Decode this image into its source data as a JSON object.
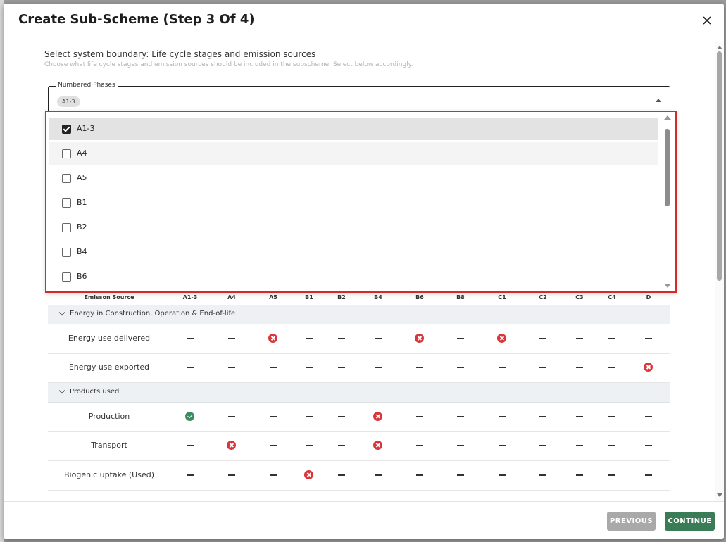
{
  "modal": {
    "title": "Create Sub-Scheme (Step 3 Of 4)",
    "close_icon": "close-icon"
  },
  "section": {
    "title": "Select system boundary: Life cycle stages and emission sources",
    "subtitle": "Choose what life cycle stages and emission sources should be included in the subscheme. Select below accordingly."
  },
  "phases_select": {
    "legend": "Numbered Phases",
    "chip": "A1-3",
    "options": [
      {
        "label": "A1-3",
        "checked": true
      },
      {
        "label": "A4",
        "checked": false
      },
      {
        "label": "A5",
        "checked": false
      },
      {
        "label": "B1",
        "checked": false
      },
      {
        "label": "B2",
        "checked": false
      },
      {
        "label": "B4",
        "checked": false
      },
      {
        "label": "B6",
        "checked": false
      }
    ]
  },
  "table": {
    "header_source": "Emisson Source",
    "columns": [
      "A1-3",
      "A4",
      "A5",
      "B1",
      "B2",
      "B4",
      "B6",
      "B8",
      "C1",
      "C2",
      "C3",
      "C4",
      "D"
    ],
    "groups": [
      {
        "label": "Energy in Construction, Operation & End-of-life",
        "rows": [
          {
            "label": "Energy use delivered",
            "cells": [
              "-",
              "-",
              "x",
              "-",
              "-",
              "-",
              "x",
              "-",
              "x",
              "-",
              "-",
              "-",
              "-"
            ]
          },
          {
            "label": "Energy use exported",
            "cells": [
              "-",
              "-",
              "-",
              "-",
              "-",
              "-",
              "-",
              "-",
              "-",
              "-",
              "-",
              "-",
              "x"
            ]
          }
        ]
      },
      {
        "label": "Products used",
        "rows": [
          {
            "label": "Production",
            "cells": [
              "check",
              "-",
              "-",
              "-",
              "-",
              "x",
              "-",
              "-",
              "-",
              "-",
              "-",
              "-",
              "-"
            ]
          },
          {
            "label": "Transport",
            "cells": [
              "-",
              "x",
              "-",
              "-",
              "-",
              "x",
              "-",
              "-",
              "-",
              "-",
              "-",
              "-",
              "-"
            ]
          },
          {
            "label": "Biogenic uptake (Used)",
            "cells": [
              "-",
              "-",
              "-",
              "x",
              "-",
              "-",
              "-",
              "-",
              "-",
              "-",
              "-",
              "-",
              "-"
            ]
          }
        ]
      }
    ]
  },
  "footer": {
    "previous_label": "PREVIOUS",
    "continue_label": "CONTINUE"
  }
}
